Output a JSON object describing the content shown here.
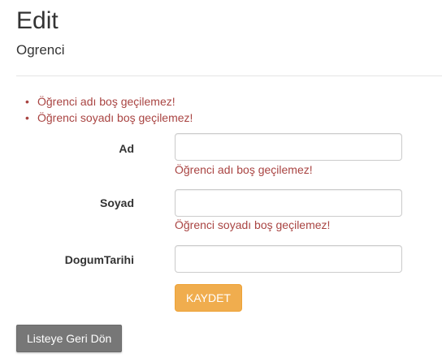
{
  "header": {
    "title": "Edit",
    "subtitle": "Ogrenci"
  },
  "validation_summary": [
    "Öğrenci adı boş geçilemez!",
    "Öğrenci soyadı boş geçilemez!"
  ],
  "form": {
    "ad": {
      "label": "Ad",
      "value": "",
      "error": "Öğrenci adı boş geçilemez!"
    },
    "soyad": {
      "label": "Soyad",
      "value": "",
      "error": "Öğrenci soyadı boş geçilemez!"
    },
    "dogum_tarihi": {
      "label": "DogumTarihi",
      "value": ""
    },
    "save_label": "KAYDET"
  },
  "back_label": "Listeye Geri Dön",
  "colors": {
    "error": "#a94442",
    "warning_button": "#f0ad4e",
    "default_button": "#777777"
  }
}
